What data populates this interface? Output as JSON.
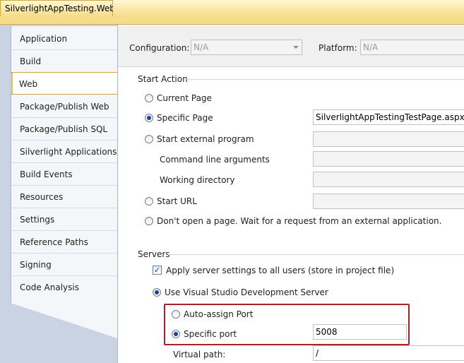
{
  "document": {
    "tab_title": "SilverlightAppTesting.Web"
  },
  "nav": {
    "items": [
      {
        "label": "Application",
        "selected": false
      },
      {
        "label": "Build",
        "selected": false
      },
      {
        "label": "Web",
        "selected": true
      },
      {
        "label": "Package/Publish Web",
        "selected": false
      },
      {
        "label": "Package/Publish SQL",
        "selected": false
      },
      {
        "label": "Silverlight Applications",
        "selected": false
      },
      {
        "label": "Build Events",
        "selected": false
      },
      {
        "label": "Resources",
        "selected": false
      },
      {
        "label": "Settings",
        "selected": false
      },
      {
        "label": "Reference Paths",
        "selected": false
      },
      {
        "label": "Signing",
        "selected": false
      },
      {
        "label": "Code Analysis",
        "selected": false
      }
    ]
  },
  "config": {
    "configuration_label": "Configuration:",
    "configuration_value": "N/A",
    "platform_label": "Platform:",
    "platform_value": "N/A"
  },
  "start_action": {
    "title": "Start Action",
    "current_page": "Current Page",
    "specific_page": "Specific Page",
    "specific_page_value": "SilverlightAppTestingTestPage.aspx",
    "start_external_program": "Start external program",
    "command_line_arguments": "Command line arguments",
    "working_directory": "Working directory",
    "start_url": "Start URL",
    "dont_open": "Don't open a page.  Wait for a request from an external application.",
    "selected": "specific_page"
  },
  "servers": {
    "title": "Servers",
    "apply_settings": "Apply server settings to all users (store in project file)",
    "apply_settings_checked": true,
    "use_vs_dev_server": "Use Visual Studio Development Server",
    "auto_assign_port": "Auto-assign Port",
    "specific_port": "Specific port",
    "specific_port_value": "5008",
    "port_selected": "specific_port",
    "virtual_path_label": "Virtual path:",
    "virtual_path_value": "/"
  },
  "colors": {
    "highlight_border": "#a4232b",
    "tab_gold": "#f5dc8a",
    "radio_dot": "#1f3f8f"
  }
}
